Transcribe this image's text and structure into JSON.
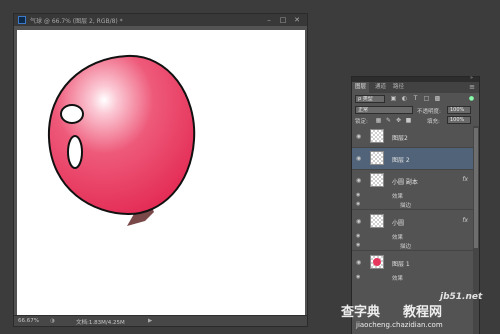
{
  "document": {
    "title": "气球 @ 66.7% (图层 2, RGB/8) *",
    "zoom": "66.67%",
    "doc_size": "文档:1.83M/4.25M"
  },
  "panel": {
    "tabs": [
      "图层",
      "通道",
      "路径"
    ],
    "filter_kind": "ρ 类型",
    "blend_mode": "正常",
    "opacity_label": "不透明度:",
    "opacity_value": "100%",
    "lock_label": "锁定:",
    "fill_label": "填充:",
    "fill_value": "100%",
    "layers": [
      {
        "name": "图层2",
        "selected": false
      },
      {
        "name": "图层 2",
        "selected": true
      },
      {
        "name": "小圆 副本",
        "fx": "fx",
        "effects_label": "效果",
        "effect": "描边"
      },
      {
        "name": "小圆",
        "fx": "fx",
        "effects_label": "效果",
        "effect": "描边"
      },
      {
        "name": "图层 1",
        "effects_label": "效果"
      }
    ]
  },
  "watermark": {
    "brand": "查字典",
    "site_name": "教程网",
    "domain1": "jb51.net",
    "domain2": "jiaocheng.chazidian.com"
  },
  "colors": {
    "balloon": "#e8375f",
    "selected_layer": "#506379",
    "panel_bg": "#535353",
    "app_bg": "#3c3c3c"
  }
}
